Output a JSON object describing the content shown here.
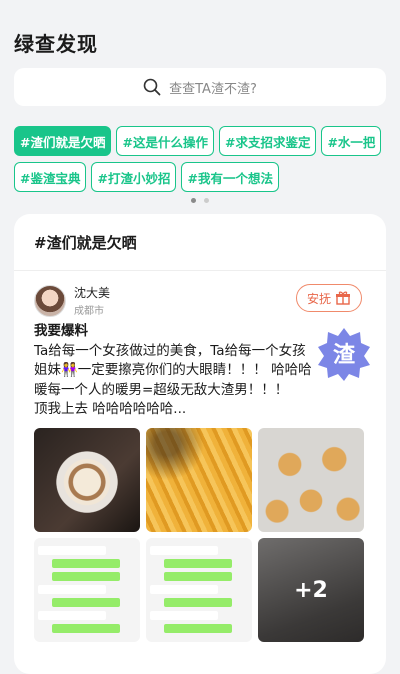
{
  "header": {
    "title": "绿查发现"
  },
  "search": {
    "placeholder": "查查TA渣不渣?"
  },
  "tags": [
    {
      "label": "#渣们就是欠晒",
      "active": true
    },
    {
      "label": "#这是什么操作",
      "active": false
    },
    {
      "label": "#求支招求鉴定",
      "active": false
    },
    {
      "label": "#水一把",
      "active": false
    },
    {
      "label": "#鉴渣宝典",
      "active": false
    },
    {
      "label": "#打渣小妙招",
      "active": false
    },
    {
      "label": "#我有一个想法",
      "active": false
    }
  ],
  "carousel": {
    "pages": 2,
    "current": 1
  },
  "card": {
    "title": "#渣们就是欠晒",
    "user": {
      "name": "沈大美",
      "city": "成都市"
    },
    "comfort_label": "安抚",
    "stamp_text": "渣",
    "post_lines": [
      "我要爆料",
      "Ta给每一个女孩做过的美食，Ta给每一个女孩",
      "姐妹👭一定要擦亮你们的大眼睛！！！ 哈哈哈",
      "暖每一个人的暖男=超级无敌大渣男！！！",
      "顶我上去 哈哈哈哈哈哈..."
    ],
    "images": [
      {
        "kind": "latte-art"
      },
      {
        "kind": "french-fries"
      },
      {
        "kind": "gingerbread-cookies"
      },
      {
        "kind": "chat-screenshot"
      },
      {
        "kind": "chat-screenshot"
      },
      {
        "kind": "more",
        "label": "+2"
      }
    ]
  },
  "colors": {
    "accent": "#19c58a",
    "comfort": "#e8674a",
    "stamp": "#7c86e6"
  }
}
